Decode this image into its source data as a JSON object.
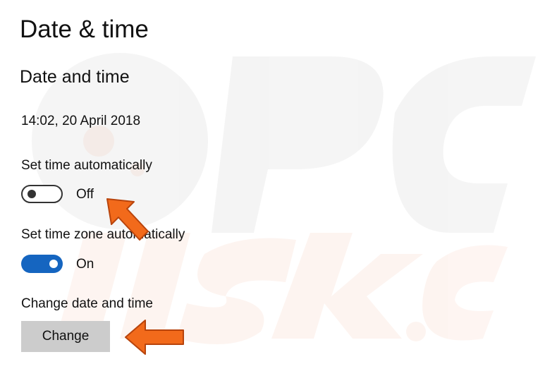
{
  "header": {
    "title": "Date & time"
  },
  "section": {
    "title": "Date and time"
  },
  "current_datetime": "14:02, 20 April 2018",
  "settings": {
    "auto_time": {
      "label": "Set time automatically",
      "state": "Off",
      "enabled": false
    },
    "auto_timezone": {
      "label": "Set time zone automatically",
      "state": "On",
      "enabled": true
    },
    "change_datetime": {
      "label": "Change date and time",
      "button": "Change"
    }
  },
  "colors": {
    "toggle_on": "#1565c0",
    "button_bg": "#cccccc",
    "annotation_arrow": "#f26a1b"
  }
}
